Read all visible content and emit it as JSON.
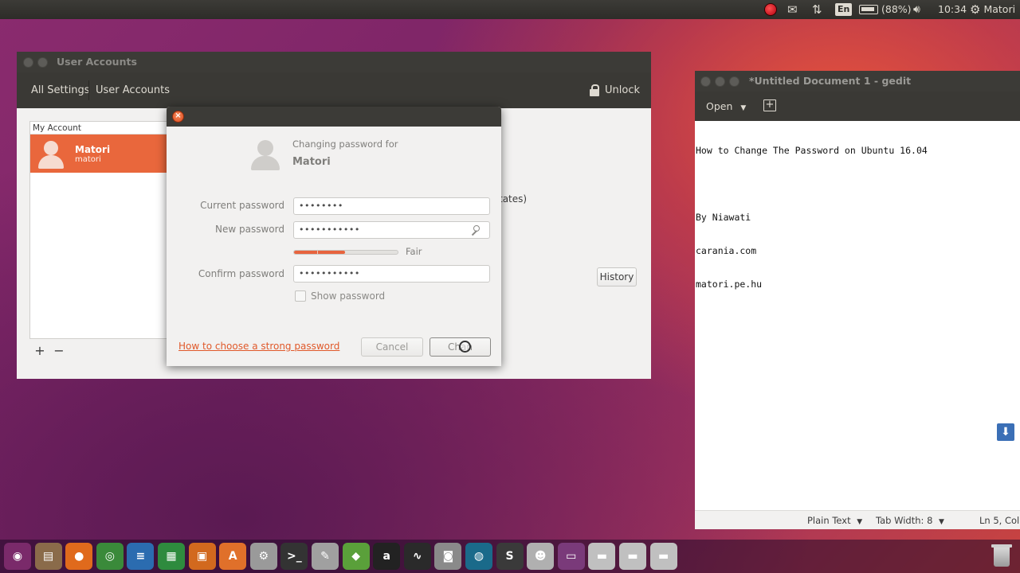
{
  "top_panel": {
    "battery": "(88%)",
    "language": "En",
    "time": "10:34",
    "user": "Matori"
  },
  "user_accounts": {
    "window_title": "User Accounts",
    "nav_all_settings": "All Settings",
    "nav_user_accounts": "User Accounts",
    "unlock_label": "Unlock",
    "list_header": "My Account",
    "account_name": "Matori",
    "account_login": "matori",
    "add_symbol": "+",
    "remove_symbol": "−",
    "partial_text": "tates)",
    "history_label": "History"
  },
  "password_dialog": {
    "changing_for": "Changing password for",
    "user": "Matori",
    "current_label": "Current password",
    "current_value": "••••••••",
    "new_label": "New password",
    "new_value": "•••••••••••",
    "strength_level": 0.49,
    "strength_label": "Fair",
    "confirm_label": "Confirm password",
    "confirm_value": "•••••••••••",
    "show_password": "Show password",
    "help_link": "How to choose a strong password",
    "cancel_label": "Cancel",
    "change_label": "Chan"
  },
  "gedit": {
    "window_title": "*Untitled Document 1 - gedit",
    "open_label": "Open",
    "lines": [
      "How to Change The Password on Ubuntu 16.04",
      "",
      "By Niawati",
      "carania.com",
      "matori.pe.hu"
    ],
    "status_mode": "Plain Text",
    "status_tab": "Tab Width: 8",
    "status_pos": "Ln 5, Col"
  },
  "dock_items": [
    {
      "name": "dash-icon",
      "color": "#7a2a6a",
      "glyph": "◉"
    },
    {
      "name": "files-icon",
      "color": "#8a6b4a",
      "glyph": "▤"
    },
    {
      "name": "firefox-icon",
      "color": "#e06a1c",
      "glyph": "●"
    },
    {
      "name": "chrome-icon",
      "color": "#3a8a3a",
      "glyph": "◎"
    },
    {
      "name": "writer-icon",
      "color": "#2b6cb0",
      "glyph": "≡"
    },
    {
      "name": "calc-icon",
      "color": "#2e8b3e",
      "glyph": "▦"
    },
    {
      "name": "impress-icon",
      "color": "#d2691e",
      "glyph": "▣"
    },
    {
      "name": "software-center-icon",
      "color": "#e0702a",
      "glyph": "A"
    },
    {
      "name": "system-settings-icon",
      "color": "#9a9a9a",
      "glyph": "⚙"
    },
    {
      "name": "terminal-icon",
      "color": "#333333",
      "glyph": ">_"
    },
    {
      "name": "text-editor-icon",
      "color": "#a0a0a0",
      "glyph": "✎"
    },
    {
      "name": "android-studio-icon",
      "color": "#5aa03a",
      "glyph": "◆"
    },
    {
      "name": "amazon-icon",
      "color": "#222222",
      "glyph": "a"
    },
    {
      "name": "system-monitor-icon",
      "color": "#2a2a2a",
      "glyph": "∿"
    },
    {
      "name": "screenshot-icon",
      "color": "#8a8a8a",
      "glyph": "◙"
    },
    {
      "name": "globe-icon",
      "color": "#1a6a8a",
      "glyph": "◍"
    },
    {
      "name": "sublime-icon",
      "color": "#3a3a3a",
      "glyph": "S"
    },
    {
      "name": "user-accounts-icon",
      "color": "#b0b0b0",
      "glyph": "☻"
    },
    {
      "name": "workspace-switcher-icon",
      "color": "#7a3a7a",
      "glyph": "▭"
    },
    {
      "name": "drive-1-icon",
      "color": "#c0c0c0",
      "glyph": "▬"
    },
    {
      "name": "drive-2-icon",
      "color": "#c0c0c0",
      "glyph": "▬"
    },
    {
      "name": "drive-3-icon",
      "color": "#c0c0c0",
      "glyph": "▬"
    }
  ]
}
